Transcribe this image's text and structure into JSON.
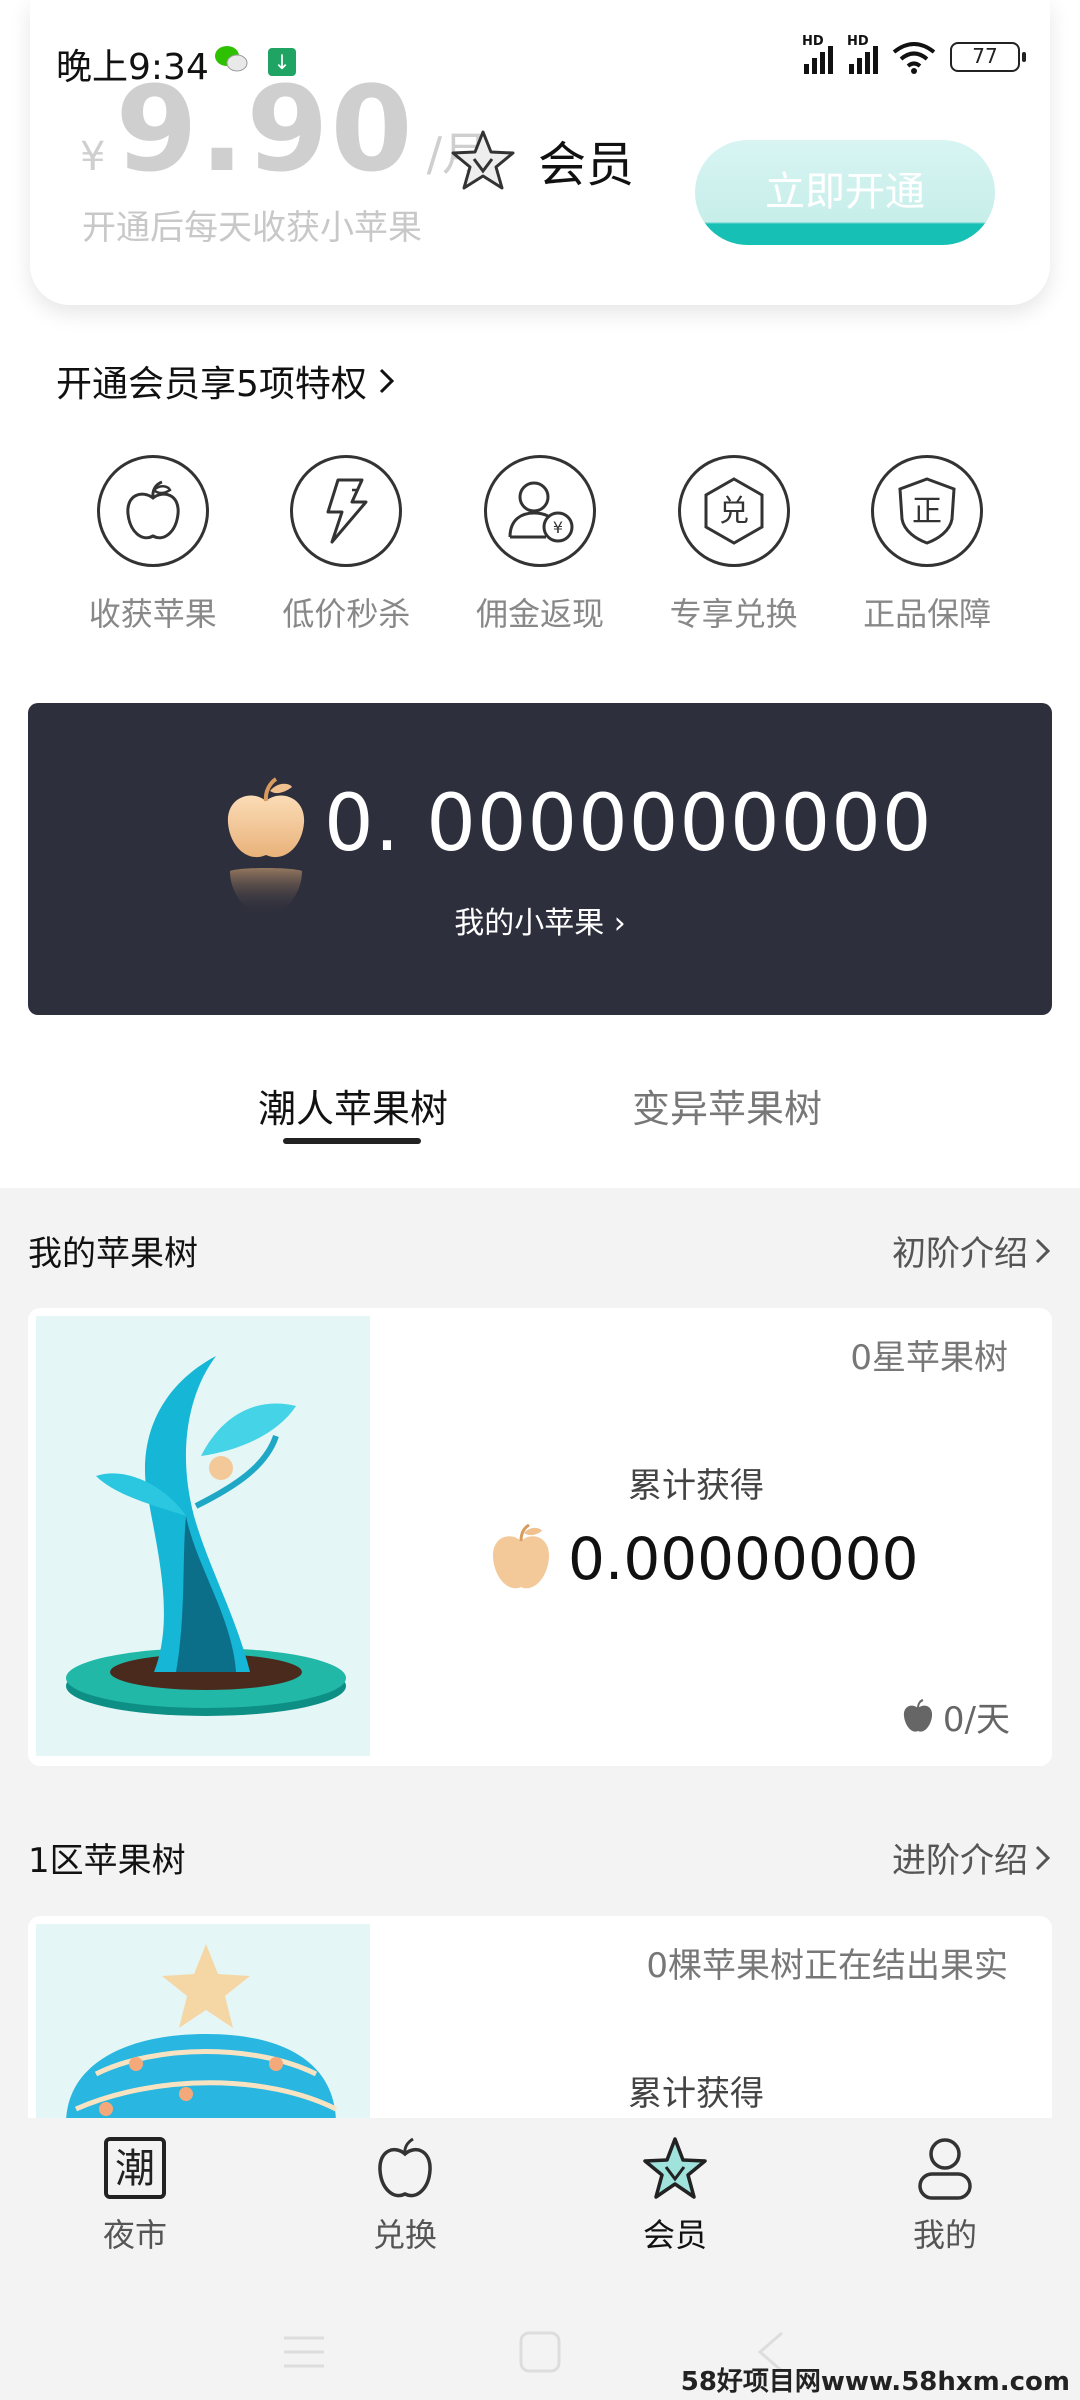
{
  "status_bar": {
    "time": "晚上9:34",
    "battery": "77",
    "hd_label": "HD"
  },
  "header": {
    "currency": "¥",
    "price": "9.90",
    "unit": "/月",
    "description": "开通后每天收获小苹果",
    "title": "会员",
    "open_button": "立即开通"
  },
  "privileges": {
    "title": "开通会员享5项特权",
    "items": [
      {
        "label": "收获苹果",
        "icon": "apple-icon"
      },
      {
        "label": "低价秒杀",
        "icon": "lightning-icon"
      },
      {
        "label": "佣金返现",
        "icon": "cashback-icon"
      },
      {
        "label": "专享兑换",
        "icon": "exchange-icon"
      },
      {
        "label": "正品保障",
        "icon": "shield-icon"
      }
    ],
    "exchange_glyph": "兑",
    "shield_glyph": "正"
  },
  "balance": {
    "value": "0. 0000000000",
    "link": "我的小苹果"
  },
  "tabs": [
    {
      "label": "潮人苹果树",
      "active": true
    },
    {
      "label": "变异苹果树",
      "active": false
    }
  ],
  "my_tree": {
    "title": "我的苹果树",
    "link": "初阶介绍",
    "star_level": "0星苹果树",
    "accumulated_label": "累计获得",
    "accumulated_value": "0.00000000",
    "per_day": "0/天"
  },
  "zone_tree": {
    "title": "1区苹果树",
    "link": "进阶介绍",
    "status": "0棵苹果树正在结出果实",
    "accumulated_label": "累计获得"
  },
  "bottom_nav": [
    {
      "label": "夜市",
      "icon": "chao-icon",
      "active": false
    },
    {
      "label": "兑换",
      "icon": "apple-icon",
      "active": false
    },
    {
      "label": "会员",
      "icon": "vip-star-icon",
      "active": true
    },
    {
      "label": "我的",
      "icon": "person-icon",
      "active": false
    }
  ],
  "nav_chao_glyph": "潮",
  "watermark": "58好项目网www.58hxm.com",
  "colors": {
    "accent": "#17c0b5",
    "dark_card": "#2e2f3c",
    "section_bg": "#f3f3f3",
    "apple": "#f3c99a"
  }
}
